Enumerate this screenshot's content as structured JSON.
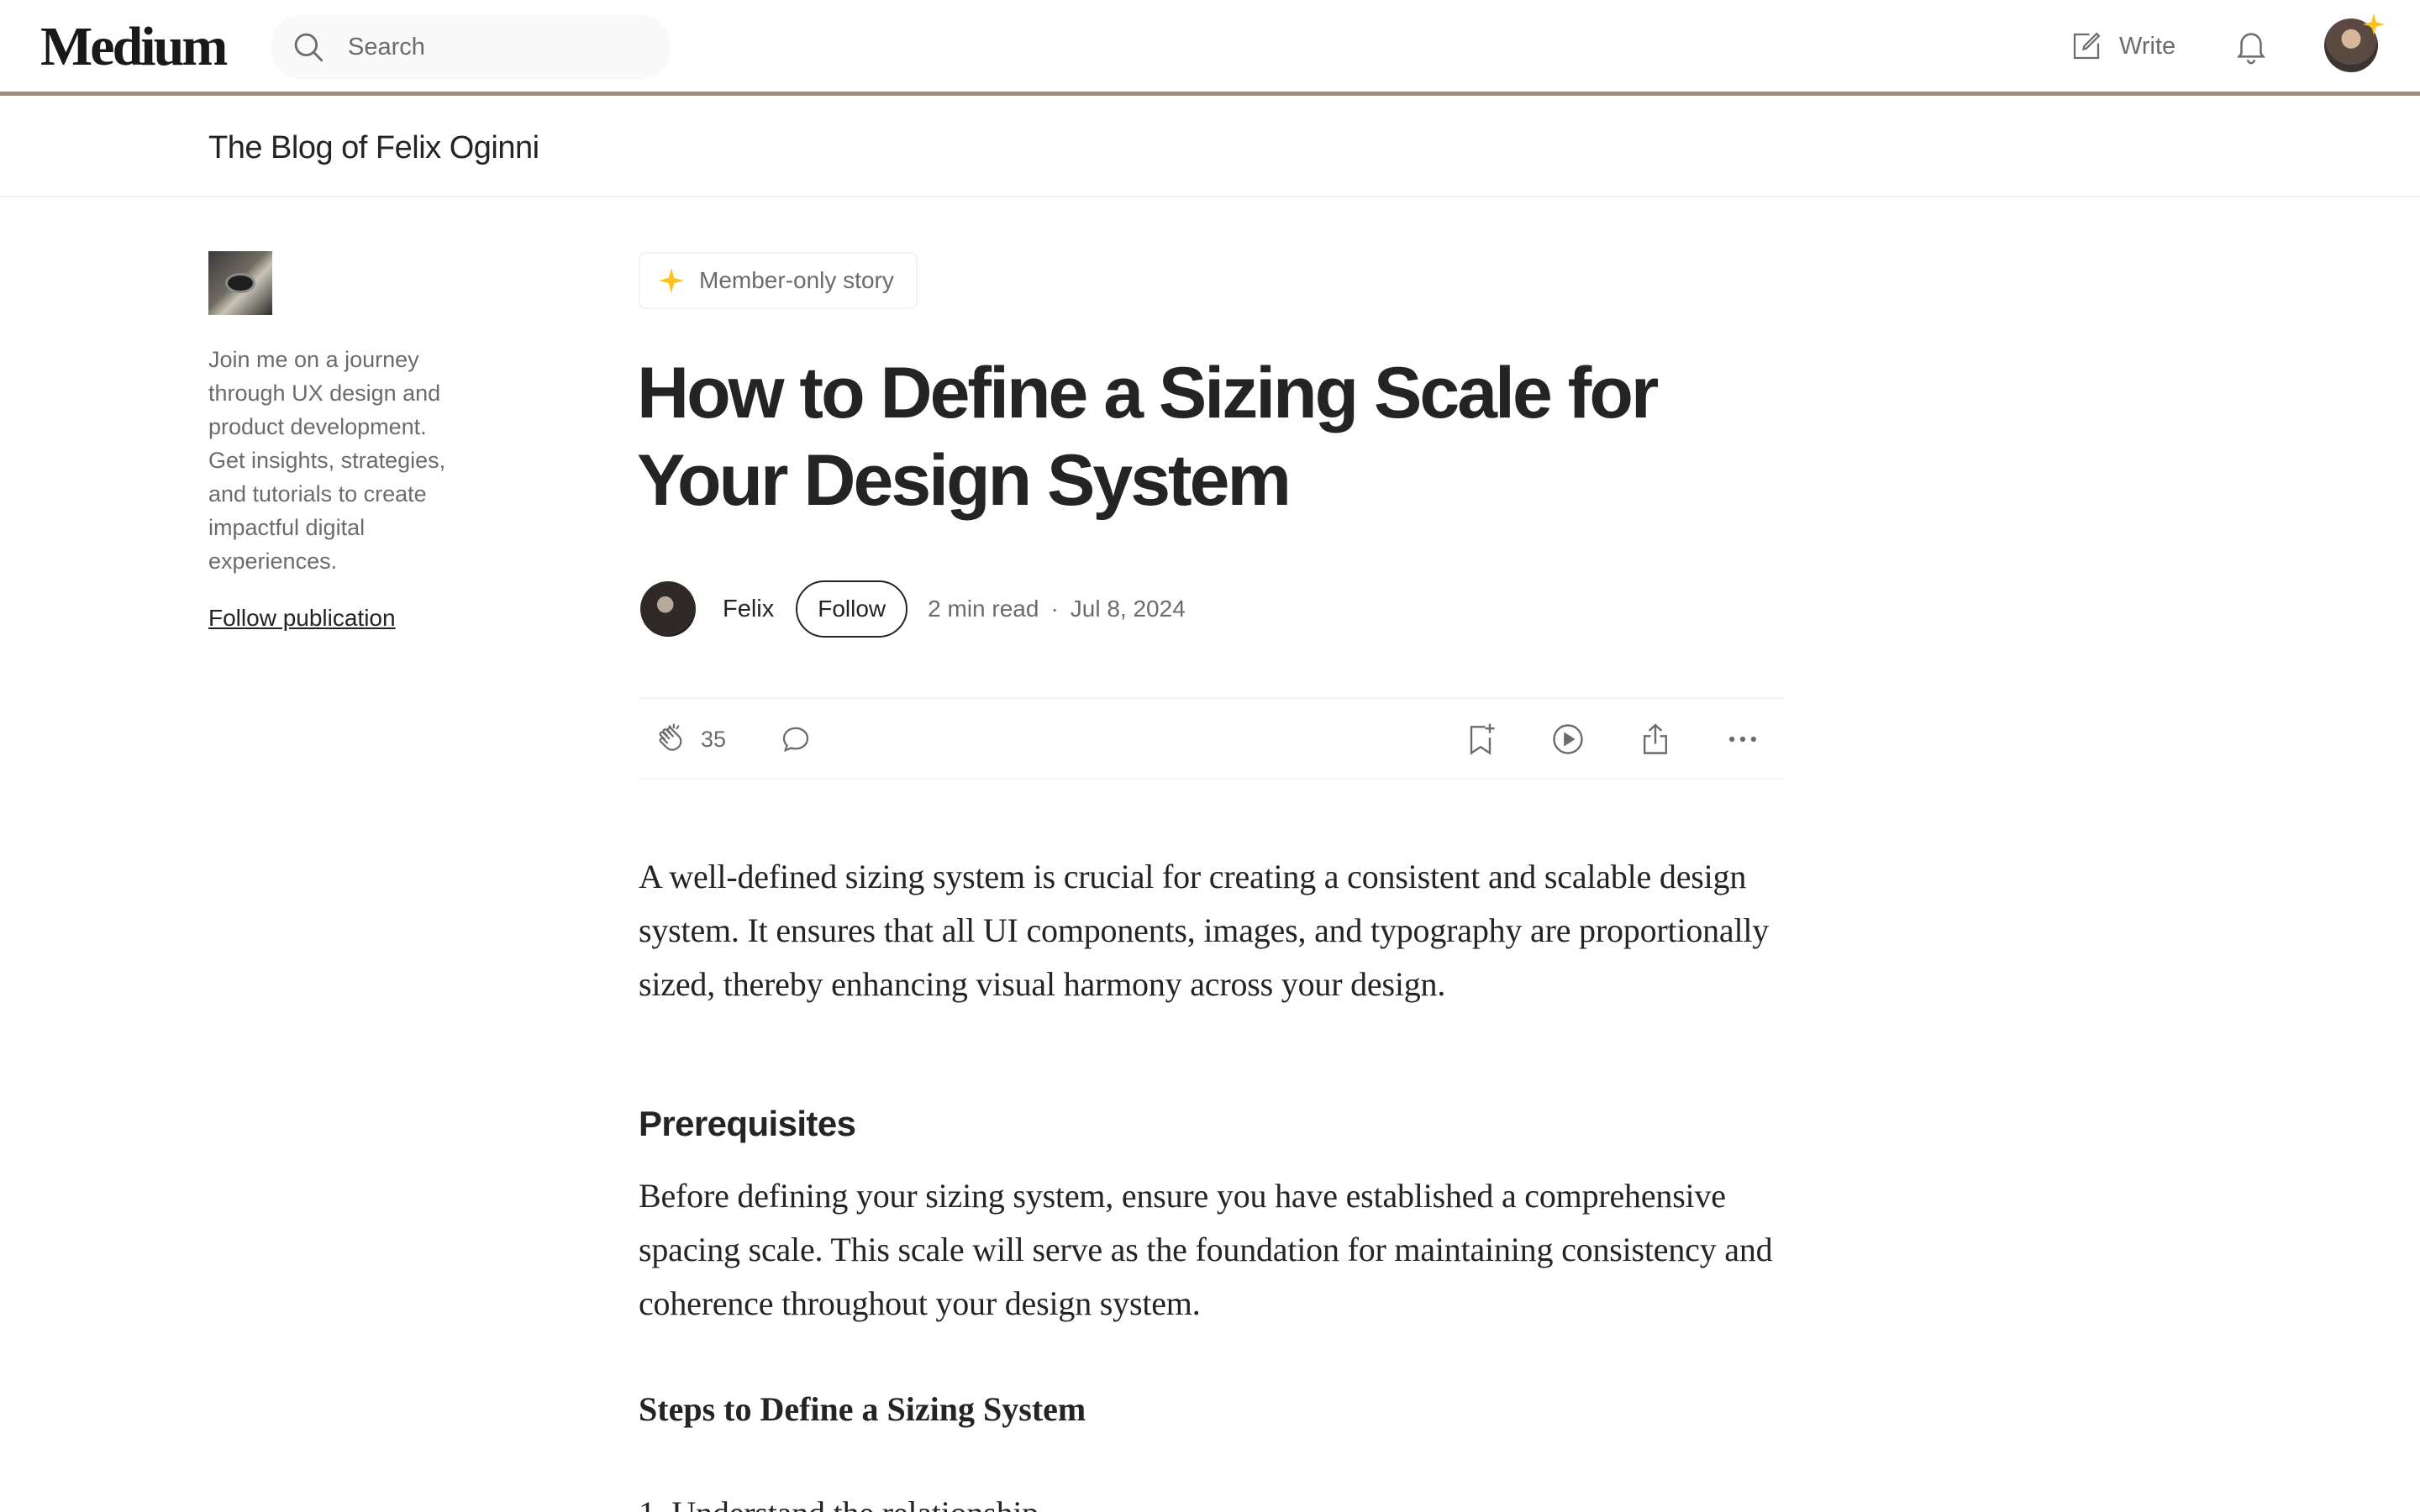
{
  "nav": {
    "logo": "Medium",
    "search_placeholder": "Search",
    "write_label": "Write"
  },
  "publication": {
    "name": "The Blog of Felix Oginni",
    "description": "Join me on a journey through UX design and product development. Get insights, strategies, and tutorials to create impactful digital experiences.",
    "follow_label": "Follow publication"
  },
  "article": {
    "badge": "Member-only story",
    "title": "How to Define a Sizing Scale for Your Design System",
    "author": "Felix",
    "follow_label": "Follow",
    "read_time": "2 min read",
    "separator": "·",
    "date": "Jul 8, 2024",
    "claps": "35",
    "paragraph1": "A well-defined sizing system is crucial for creating a consistent and scalable design system. It ensures that all UI components, images, and typography are proportionally sized, thereby enhancing visual harmony across your design.",
    "heading_prerequisites": "Prerequisites",
    "paragraph2": "Before defining your sizing system, ensure you have established a comprehensive spacing scale. This scale will serve as the foundation for maintaining consistency and coherence throughout your design system.",
    "heading_steps": "Steps to Define a Sizing System",
    "paragraph3": "1. Understand the relationship"
  },
  "colors": {
    "text_primary": "#242424",
    "text_secondary": "#6b6b6b",
    "accent_star": "#ffc017",
    "nav_border": "#a48a78"
  }
}
